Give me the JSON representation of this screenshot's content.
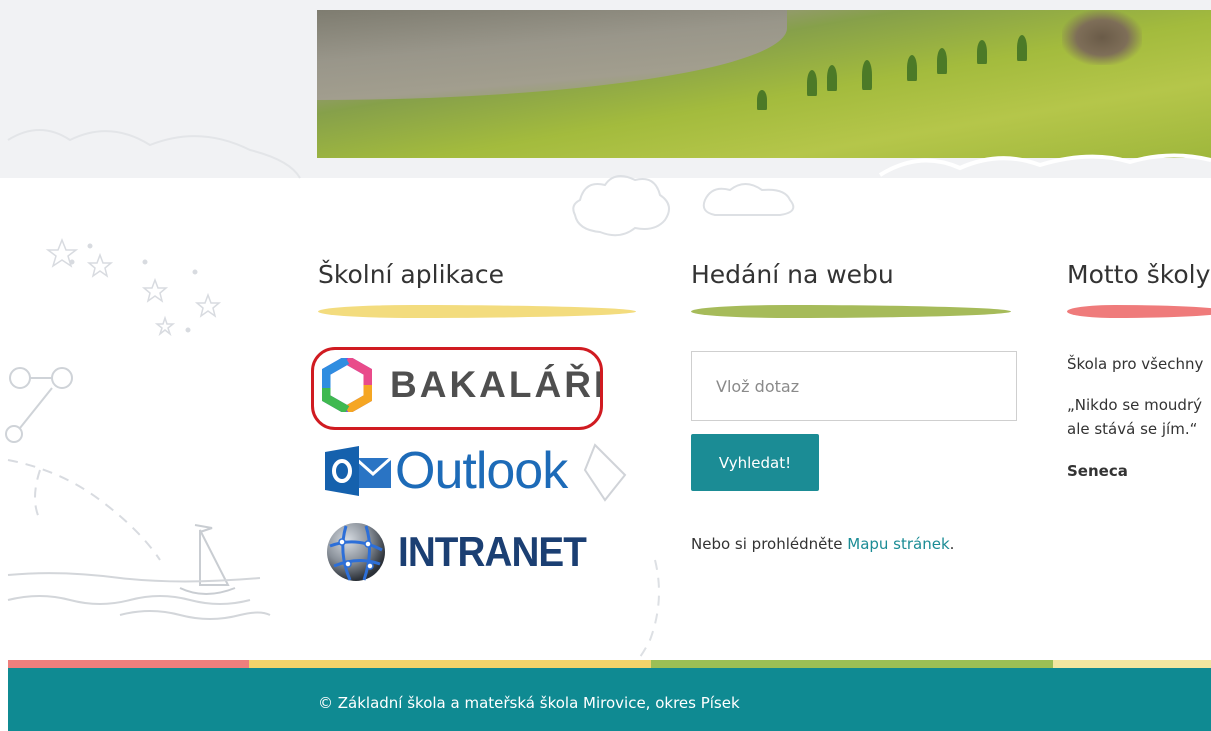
{
  "sections": {
    "apps_title": "Školní aplikace",
    "search_title": "Hedání na webu",
    "motto_title": "Motto školy"
  },
  "apps": {
    "bakalari_label": "BAKALÁŘI",
    "outlook_label": "Outlook",
    "intranet_label": "INTRANET"
  },
  "search": {
    "placeholder": "Vlož dotaz",
    "button_label": "Vyhledat!",
    "sitemap_prefix": "Nebo si prohlédněte ",
    "sitemap_link": "Mapu stránek",
    "sitemap_suffix": "."
  },
  "motto": {
    "line1": "Škola pro všechny",
    "line2": "„Nikdo se moudrý",
    "line3": "ale stává se jím.“",
    "author": "Seneca"
  },
  "footer": {
    "copyright": "© Základní škola a mateřská škola Mirovice, okres Písek"
  },
  "colors": {
    "teal": "#0f8a92",
    "button_teal": "#1b8c95",
    "brush_yellow": "#f3dc7e",
    "brush_green": "#a6bb5a",
    "brush_red": "#ef7b7b",
    "highlight_red": "#d01b21",
    "stripe_red": "#ee7f7d",
    "stripe_yellow": "#f2d36b",
    "stripe_green": "#9bbf55"
  }
}
